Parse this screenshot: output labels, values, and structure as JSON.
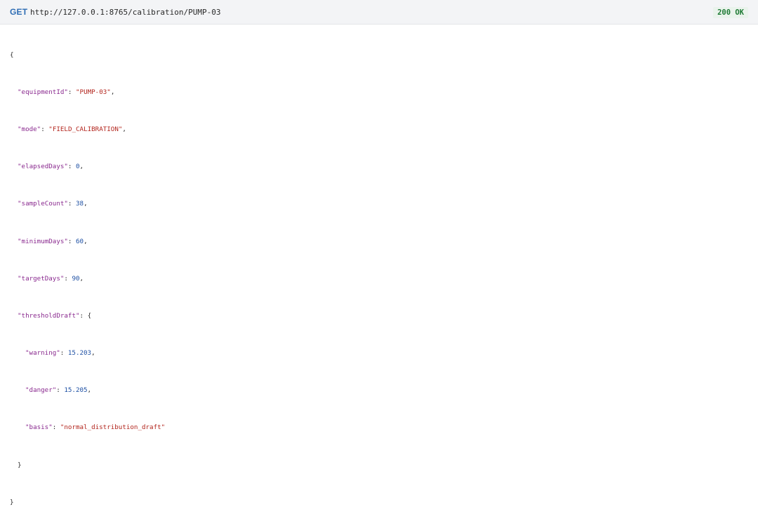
{
  "request": {
    "method": "GET",
    "url": "http://127.0.0.1:8765/calibration/PUMP-03",
    "status": "200 OK"
  },
  "response": {
    "equipmentId": "PUMP-03",
    "mode": "FIELD_CALIBRATION",
    "elapsedDays": "0",
    "sampleCount": "38",
    "minimumDays": "60",
    "targetDays": "90",
    "thresholdDraft": {
      "warning": "15.203",
      "danger": "15.205",
      "basis": "normal_distribution_draft"
    }
  },
  "colors": {
    "method": "#2e6db4",
    "status": "#1e7a34",
    "key": "#8a2a8f",
    "string": "#b3261e",
    "number": "#1d4fa3"
  }
}
